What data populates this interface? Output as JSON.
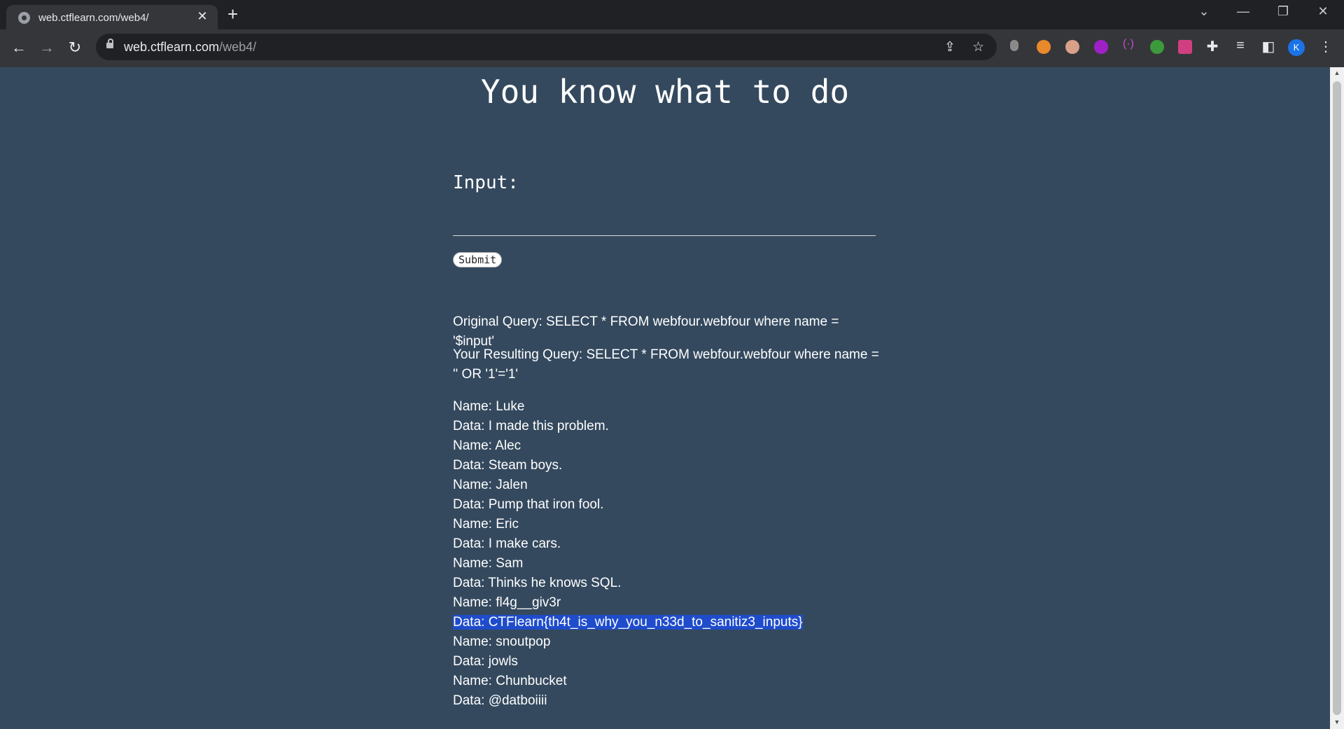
{
  "browser": {
    "tab_title": "web.ctflearn.com/web4/",
    "tab_close": "✕",
    "new_tab": "+",
    "url_host": "web.ctflearn.com",
    "url_path": "/web4/",
    "avatar_letter": "K",
    "window_controls": {
      "dropdown": "⌄",
      "minimize": "—",
      "restore": "❐",
      "close": "✕"
    }
  },
  "page": {
    "heading": "You know what to do",
    "input_label": "Input:",
    "input_value": "",
    "submit_label": "Submit",
    "original_query": "Original Query: SELECT * FROM webfour.webfour where name = '$input'",
    "resulting_query": "Your Resulting Query: SELECT * FROM webfour.webfour where name = '' OR '1'='1'",
    "results": [
      "Name: Luke",
      "Data: I made this problem.",
      "Name: Alec",
      "Data: Steam boys.",
      "Name: Jalen",
      "Data: Pump that iron fool.",
      "Name: Eric",
      "Data: I make cars.",
      "Name: Sam",
      "Data: Thinks he knows SQL.",
      "Name: fl4g__giv3r",
      "Data: CTFlearn{th4t_is_why_you_n33d_to_sanitiz3_inputs}",
      "Name: snoutpop",
      "Data: jowls",
      "Name: Chunbucket",
      "Data: @datboiiii"
    ]
  },
  "colors": {
    "page_bg": "#34495e",
    "chrome_bg": "#202124",
    "toolbar_bg": "#35363a",
    "selection": "#1f4ccb"
  }
}
